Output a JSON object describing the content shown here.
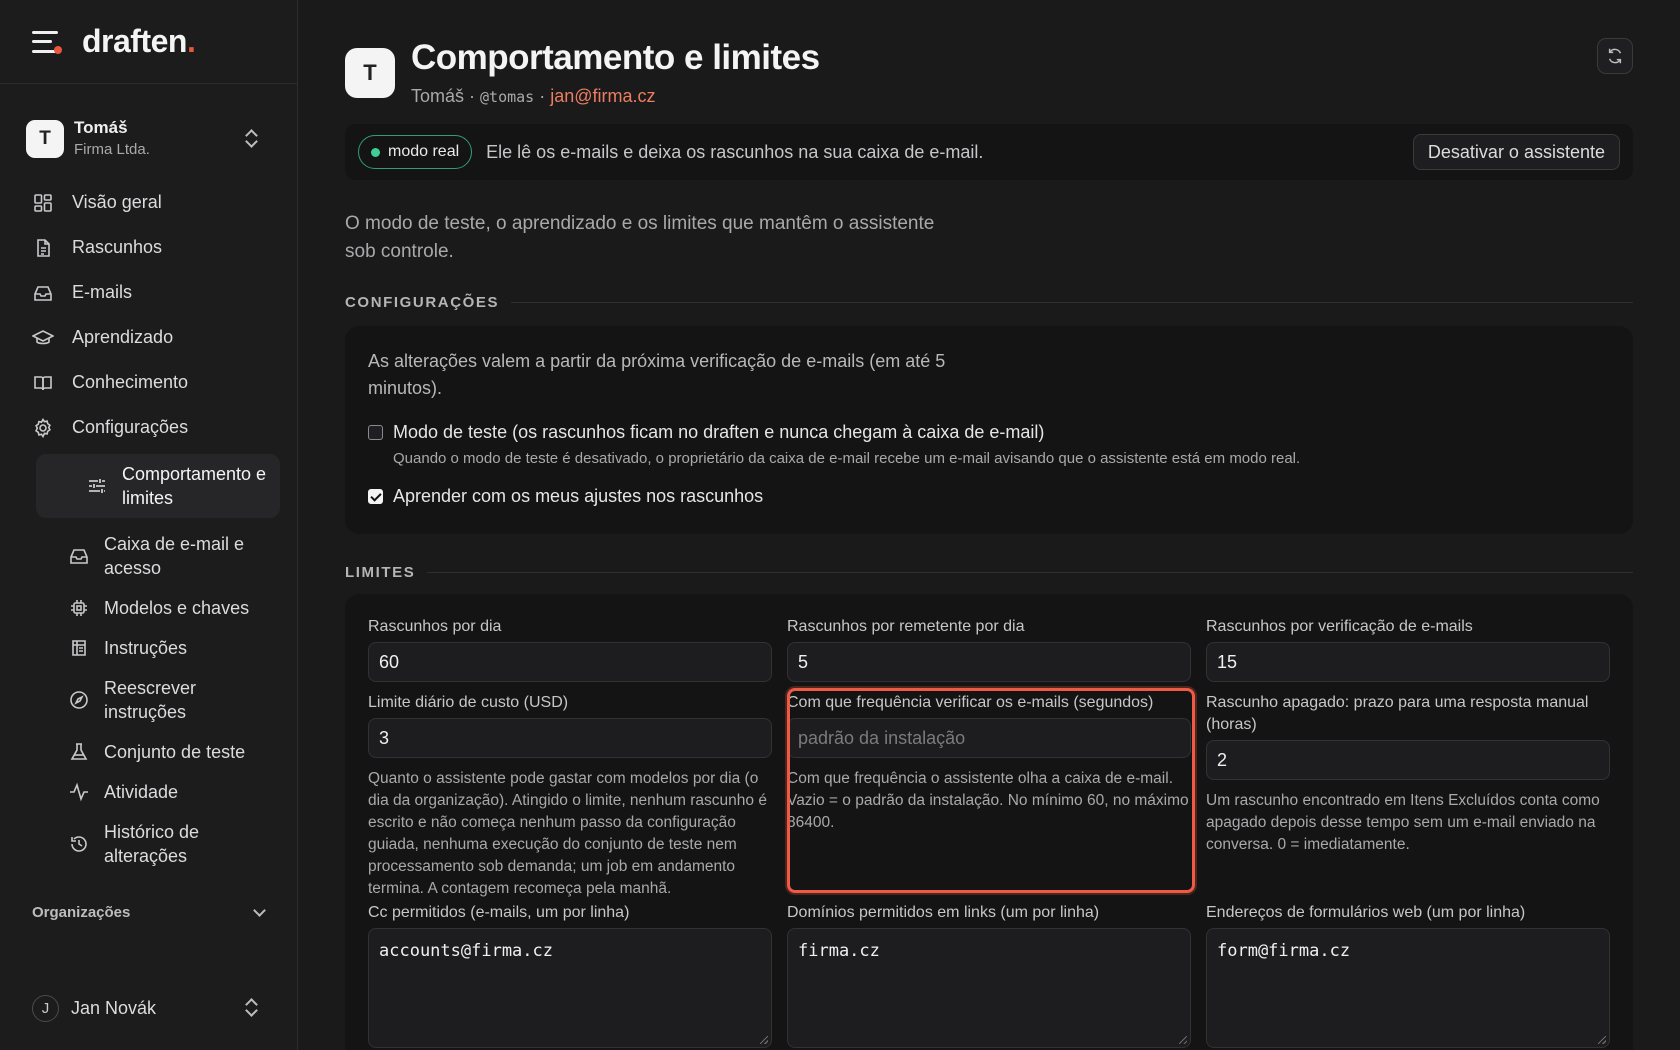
{
  "brand": {
    "name": "draften",
    "dot": "."
  },
  "org": {
    "initial": "T",
    "name": "Tomáš",
    "company": "Firma Ltda."
  },
  "nav": {
    "items": [
      {
        "label": "Visão geral",
        "icon": "grid-icon"
      },
      {
        "label": "Rascunhos",
        "icon": "document-icon"
      },
      {
        "label": "E-mails",
        "icon": "inbox-icon"
      },
      {
        "label": "Aprendizado",
        "icon": "graduation-cap-icon"
      },
      {
        "label": "Conhecimento",
        "icon": "book-icon"
      },
      {
        "label": "Configurações",
        "icon": "gear-icon"
      }
    ],
    "sub": [
      {
        "label": "Comportamento e limites",
        "icon": "sliders-icon"
      },
      {
        "label": "Caixa de e-mail e acesso",
        "icon": "inbox-icon"
      },
      {
        "label": "Modelos e chaves",
        "icon": "chip-icon"
      },
      {
        "label": "Instruções",
        "icon": "list-icon"
      },
      {
        "label": "Reescrever instruções",
        "icon": "compass-icon"
      },
      {
        "label": "Conjunto de teste",
        "icon": "flask-icon"
      },
      {
        "label": "Atividade",
        "icon": "activity-icon"
      },
      {
        "label": "Histórico de alterações",
        "icon": "history-icon"
      }
    ],
    "organizations": "Organizações"
  },
  "user": {
    "initial": "J",
    "name": "Jan Novák"
  },
  "header": {
    "initial": "T",
    "title": "Comportamento e limites",
    "name": "Tomáš",
    "sep": " · ",
    "handle": "@tomas",
    "email": "jan@firma.cz"
  },
  "mode": {
    "pill": "modo real",
    "text": "Ele lê os e-mails e deixa os rascunhos na sua caixa de e-mail.",
    "disable_button": "Desativar o assistente"
  },
  "intro": "O modo de teste, o aprendizado e os limites que mantêm o assistente sob controle.",
  "config": {
    "heading": "CONFIGURAÇÕES",
    "note": "As alterações valem a partir da próxima verificação de e-mails (em até 5 minutos).",
    "test_mode_label": "Modo de teste (os rascunhos ficam no draften e nunca chegam à caixa de e-mail)",
    "test_mode_checked": false,
    "test_mode_help": "Quando o modo de teste é desativado, o proprietário da caixa de e-mail recebe um e-mail avisando que o assistente está em modo real.",
    "learn_label": "Aprender com os meus ajustes nos rascunhos",
    "learn_checked": true
  },
  "limits": {
    "heading": "LIMITES",
    "drafts_per_day": {
      "label": "Rascunhos por dia",
      "value": "60"
    },
    "drafts_per_sender": {
      "label": "Rascunhos por remetente por dia",
      "value": "5"
    },
    "drafts_per_check": {
      "label": "Rascunhos por verificação de e-mails",
      "value": "15"
    },
    "cost_limit": {
      "label": "Limite diário de custo (USD)",
      "value": "3",
      "help": "Quanto o assistente pode gastar com modelos por dia (o dia da organização). Atingido o limite, nenhum rascunho é escrito e não começa nenhum passo da configuração guiada, nenhuma execução do conjunto de teste nem processamento sob demanda; um job em andamento termina. A contagem recomeça pela manhã."
    },
    "check_frequency": {
      "label": "Com que frequência verificar os e-mails (segundos)",
      "placeholder": "padrão da instalação",
      "help": "Com que frequência o assistente olha a caixa de e-mail. Vazio = o padrão da instalação. No mínimo 60, no máximo 86400."
    },
    "deleted_draft": {
      "label": "Rascunho apagado: prazo para uma resposta manual (horas)",
      "value": "2",
      "help": "Um rascunho encontrado em Itens Excluídos conta como apagado depois desse tempo sem um e-mail enviado na conversa. 0 = imediatamente."
    },
    "allowed_cc": {
      "label": "Cc permitidos (e-mails, um por linha)",
      "value": "accounts@firma.cz"
    },
    "allowed_domains": {
      "label": "Domínios permitidos em links (um por linha)",
      "value": "firma.cz"
    },
    "web_forms": {
      "label": "Endereços de formulários web (um por linha)",
      "value": "form@firma.cz"
    }
  },
  "colors": {
    "accent": "#e8573f",
    "live": "#3fcf95",
    "highlight": "#ef5a44"
  }
}
